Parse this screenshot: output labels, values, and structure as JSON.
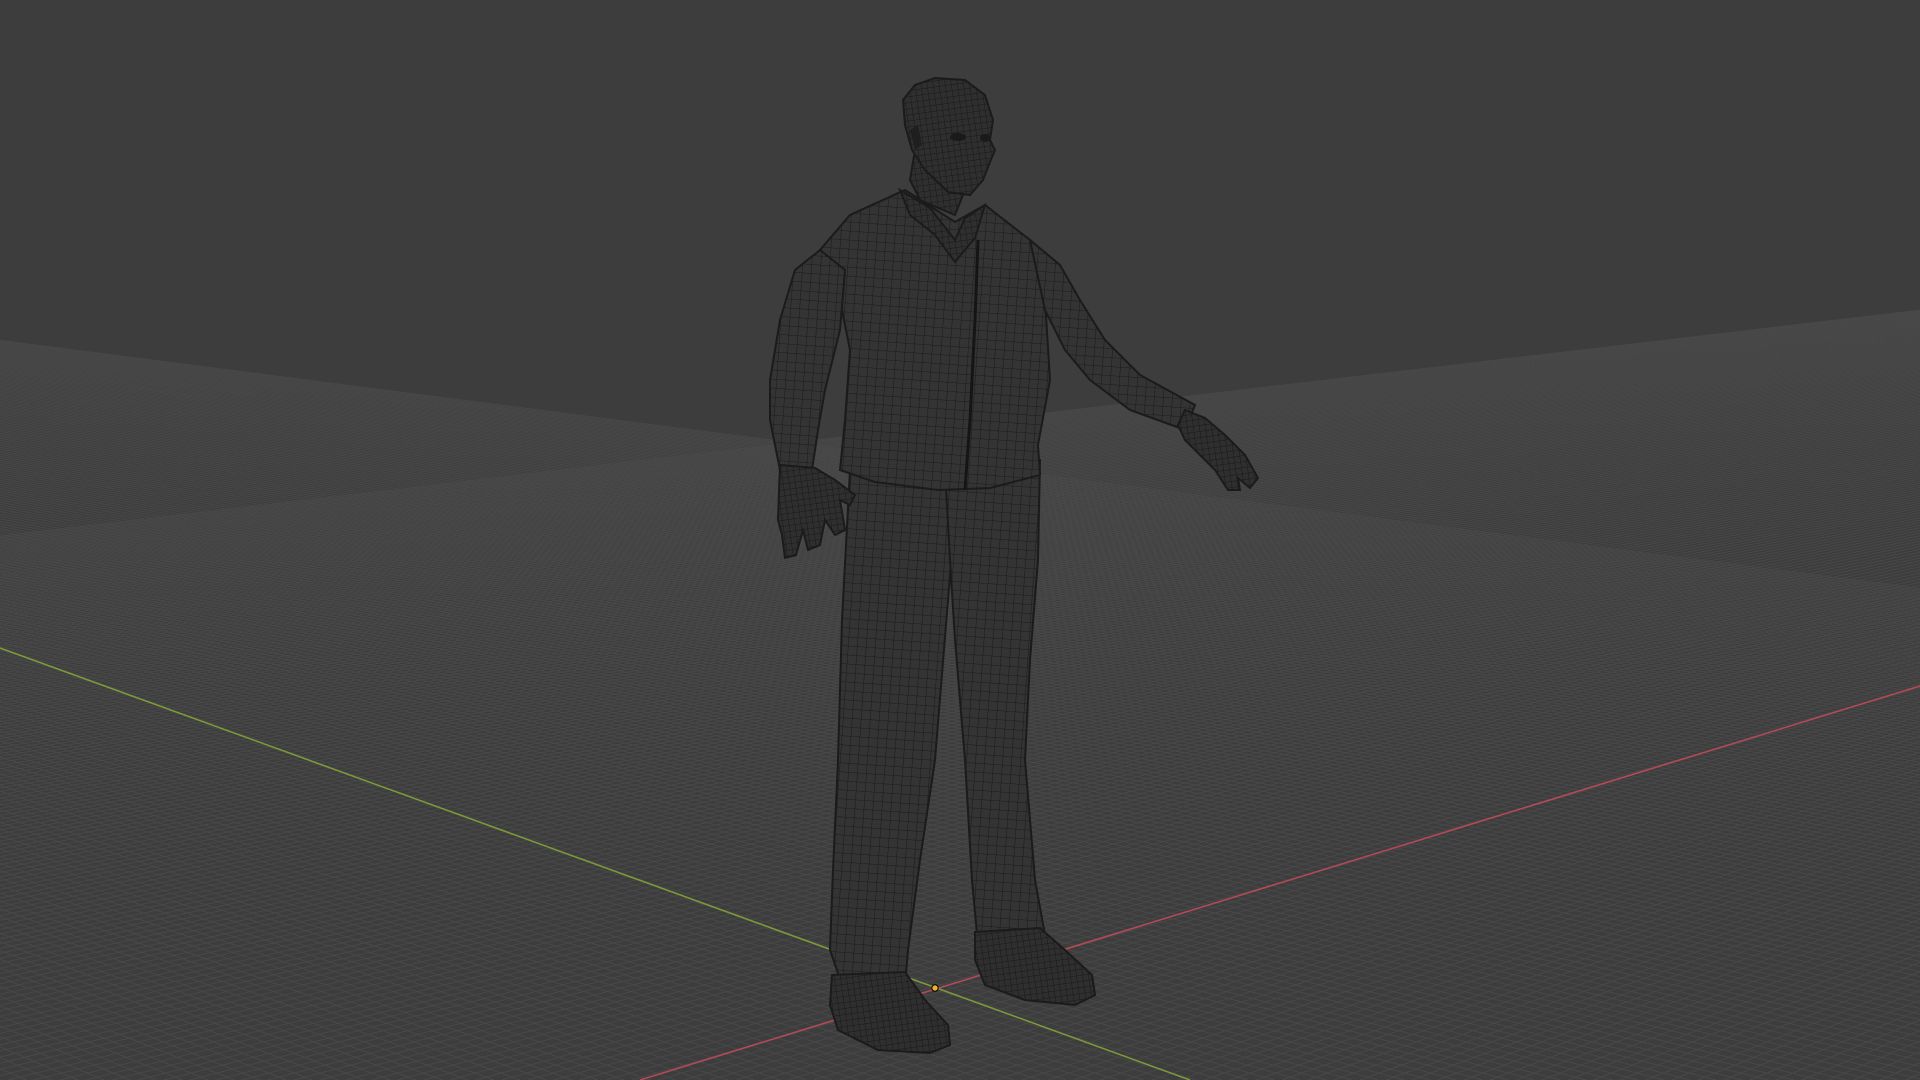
{
  "viewport": {
    "background_color": "#3d3d3d",
    "grid_line_color": "#4a4a4a",
    "x_axis_color": "#b24a57",
    "y_axis_color": "#7a9a3a",
    "wire_color": "#1b1b1b",
    "mesh_fill_color": "#343434",
    "origin_color": "#f0b02a"
  },
  "scene": {
    "object_kind": "character-mesh",
    "display_mode": "wireframe-overlay"
  }
}
